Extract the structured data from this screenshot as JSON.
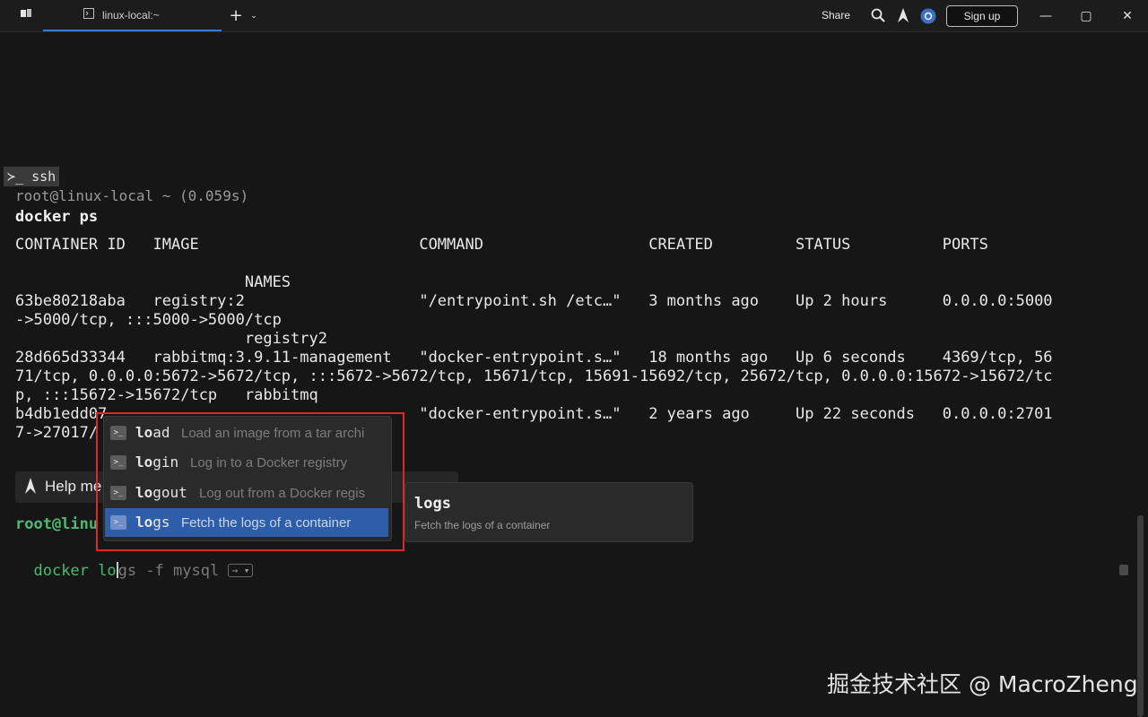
{
  "titlebar": {
    "tab_label": "linux-local:~",
    "share_label": "Share",
    "signup_label": "Sign up",
    "icons": [
      "warp-menu-icon",
      "terminal-tab-icon",
      "new-tab-plus-icon",
      "chevron-down-icon",
      "search-icon",
      "warp-logo-icon",
      "settings-icon",
      "minimize-icon",
      "maximize-icon",
      "close-icon"
    ]
  },
  "block": {
    "badge": "ssh",
    "prompt": "root@linux-local ~ (0.059s)",
    "command": "docker ps",
    "lines": [
      "CONTAINER ID   IMAGE                        COMMAND                  CREATED         STATUS          PORTS",
      "",
      "                         NAMES",
      "63be80218aba   registry:2                   \"/entrypoint.sh /etc…\"   3 months ago    Up 2 hours      0.0.0.0:5000",
      "->5000/tcp, :::5000->5000/tcp",
      "                         registry2",
      "28d665d33344   rabbitmq:3.9.11-management   \"docker-entrypoint.s…\"   18 months ago   Up 6 seconds    4369/tcp, 56",
      "71/tcp, 0.0.0.0:5672->5672/tcp, :::5672->5672/tcp, 15671/tcp, 15691-15692/tcp, 25672/tcp, 0.0.0.0:15672->15672/tc",
      "p, :::15672->15672/tcp   rabbitmq",
      "b4db1edd07                                  \"docker-entrypoint.s…\"   2 years ago     Up 22 seconds   0.0.0.0:2701",
      "7->27017/"
    ]
  },
  "help_bar": {
    "label": "Help me"
  },
  "input": {
    "prompt": "root@linu",
    "typed_prefix": "docker lo",
    "ghost_suffix": "gs -f mysql",
    "hint": "→ ▾"
  },
  "autocomplete": {
    "items": [
      {
        "name_bold": "lo",
        "name_rest": "ad",
        "description": "Load an image from a tar archi",
        "selected": false
      },
      {
        "name_bold": "lo",
        "name_rest": "gin",
        "description": "Log in to a Docker registry",
        "selected": false
      },
      {
        "name_bold": "lo",
        "name_rest": "gout",
        "description": "Log out from a Docker regis",
        "selected": false
      },
      {
        "name_bold": "lo",
        "name_rest": "gs",
        "description": "Fetch the logs of a container",
        "selected": true
      }
    ],
    "item_icon": ">_"
  },
  "detail": {
    "title": "logs",
    "description": "Fetch the logs of a container"
  },
  "watermark": "掘金技术社区 @ MacroZheng",
  "colors": {
    "accent": "#2f5ea8",
    "prompt_green": "#4fb871",
    "highlight_box": "#e0262b",
    "background": "#161616"
  }
}
